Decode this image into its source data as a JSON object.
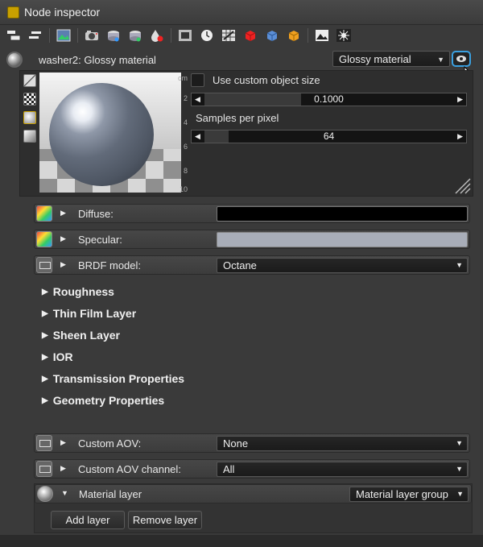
{
  "window": {
    "title": "Node inspector"
  },
  "toolbar": {
    "icons": [
      "collapse-icon",
      "expand-icon",
      "image-icon",
      "camera-icon",
      "disc-stack-icon",
      "disc-stack-alt-icon",
      "paint-drop-icon",
      "frame-icon",
      "clock-icon",
      "grid-icon",
      "red-cube-icon",
      "blue-cube-icon",
      "orange-cube-icon",
      "picture-icon",
      "sparkle-icon"
    ]
  },
  "node": {
    "title": "washer2: Glossy material",
    "type_select": "Glossy material"
  },
  "preview": {
    "ruler_unit": "cm",
    "ruler_ticks": [
      "2",
      "4",
      "6",
      "8",
      "10"
    ],
    "custom_size_label": "Use custom object size",
    "custom_size_value": "0.1000",
    "samples_label": "Samples per pixel",
    "samples_value": "64"
  },
  "properties": {
    "diffuse_label": "Diffuse:",
    "diffuse_color": "#000000",
    "specular_label": "Specular:",
    "specular_color": "#a8adb8",
    "brdf_label": "BRDF model:",
    "brdf_value": "Octane"
  },
  "sections": [
    "Roughness",
    "Thin Film Layer",
    "Sheen Layer",
    "IOR",
    "Transmission Properties",
    "Geometry Properties"
  ],
  "aov": {
    "custom_aov_label": "Custom AOV:",
    "custom_aov_value": "None",
    "channel_label": "Custom AOV channel:",
    "channel_value": "All"
  },
  "material_layer": {
    "label": "Material layer",
    "select": "Material layer group",
    "add_button": "Add layer",
    "remove_button": "Remove layer"
  },
  "colors": {
    "accent_focus": "#3aa0e0",
    "panel_bg": "#3a3a3a"
  }
}
